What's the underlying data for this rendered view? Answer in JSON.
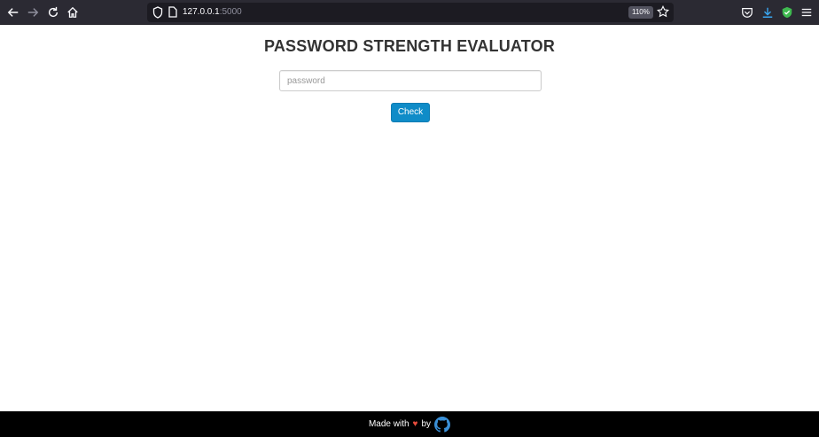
{
  "browser": {
    "url_host": "127.0.0.1",
    "url_port": ":5000",
    "zoom": "110%"
  },
  "page": {
    "title": "PASSWORD STRENGTH EVALUATOR",
    "password_placeholder": "password",
    "check_label": "Check"
  },
  "footer": {
    "made_with": "Made with",
    "heart": "♥",
    "by": "by"
  }
}
